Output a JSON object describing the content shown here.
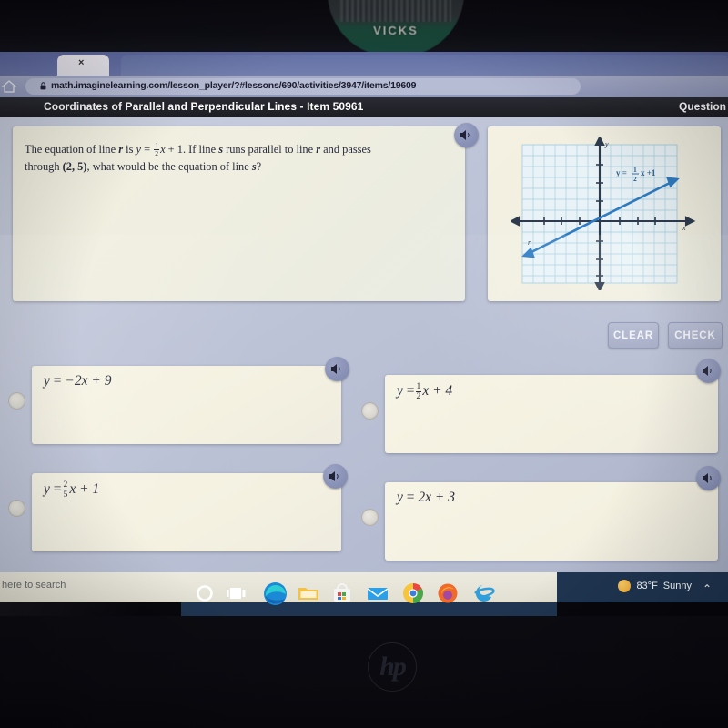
{
  "photo": {
    "product_label": "VICKS",
    "laptop_brand": "hp"
  },
  "browser": {
    "tab_close_glyph": "×",
    "new_tab_glyph": "+",
    "url": "math.imaginelearning.com/lesson_player/?#lessons/690/activities/3947/items/19609",
    "home_icon": "home-icon",
    "lock_icon": "lock-icon"
  },
  "appbar": {
    "title": "Coordinates of Parallel and Perpendicular Lines - Item 50961",
    "right_label": "Question"
  },
  "question": {
    "line1_a": "The equation of line ",
    "line1_r": "r",
    "line1_b": " is ",
    "eq_y": "y",
    "eq_eq": " = ",
    "eq_num": "1",
    "eq_den": "2",
    "eq_x": "x",
    "eq_plus": " + 1",
    "line1_c": ". If line ",
    "line1_s": "s",
    "line1_d": " runs parallel to line ",
    "line1_r2": "r",
    "line1_e": " and passes",
    "line2_a": "through ",
    "line2_point": "(2, 5)",
    "line2_b": ", what would be the equation of line ",
    "line2_s": "s",
    "line2_c": "?",
    "speaker_icon": "speaker-icon"
  },
  "graph": {
    "label_y": "y",
    "label_x": "x",
    "line_label_y": "y",
    "line_label_eq": "=",
    "line_label_num": "1",
    "line_label_den": "2",
    "line_label_x": "x",
    "line_label_plus": "+1",
    "line_name": "r",
    "line_color": "#2f7cc4",
    "grid_color": "#9ec6d8",
    "axis_color": "#2e3b4e",
    "equation_described": "y = 1/2 x + 1",
    "slope": 0.5,
    "intercept": 1
  },
  "actions": {
    "clear": "CLEAR",
    "check": "CHECK"
  },
  "options": [
    {
      "id": "A",
      "y": "y",
      "eq": "=",
      "body": "−2x + 9",
      "fraction": null,
      "speaker_icon": "speaker-icon",
      "selected": false
    },
    {
      "id": "B",
      "y": "y",
      "eq": "=",
      "body": "x + 4",
      "fraction": {
        "num": "1",
        "den": "2"
      },
      "speaker_icon": "speaker-icon",
      "selected": false
    },
    {
      "id": "C",
      "y": "y",
      "eq": "=",
      "body": "x + 1",
      "fraction": {
        "num": "2",
        "den": "5"
      },
      "speaker_icon": "speaker-icon",
      "selected": false
    },
    {
      "id": "D",
      "y": "y",
      "eq": "=",
      "body": "2x + 3",
      "fraction": null,
      "speaker_icon": "speaker-icon",
      "selected": false
    }
  ],
  "taskbar": {
    "search_placeholder": "here to search",
    "icons": [
      "cortana-icon",
      "task-view-icon",
      "edge-icon",
      "file-explorer-icon",
      "microsoft-store-icon",
      "mail-icon",
      "chrome-icon",
      "firefox-icon",
      "internet-explorer-icon"
    ],
    "weather_temp": "83°F",
    "weather_cond": "Sunny",
    "tray_chevron": "⌃"
  }
}
